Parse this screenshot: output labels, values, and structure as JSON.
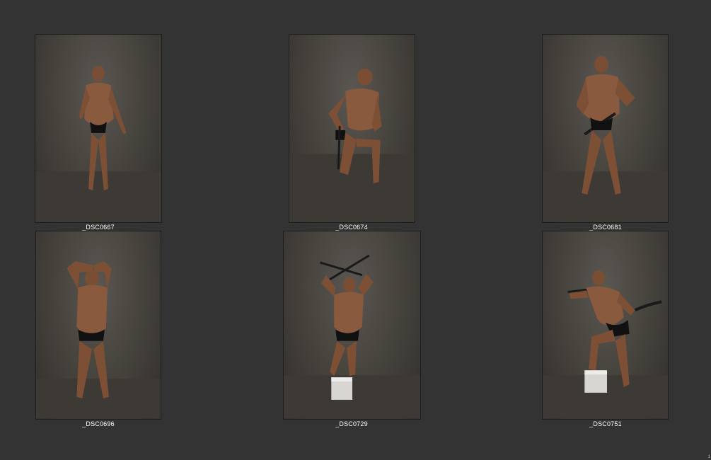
{
  "contact_sheet": {
    "photos": [
      {
        "filename": "_DSC0667",
        "pose": "standing-figure"
      },
      {
        "filename": "_DSC0674",
        "pose": "kneeling-figure-with-sword"
      },
      {
        "filename": "_DSC0681",
        "pose": "standing-figure-with-sword"
      },
      {
        "filename": "_DSC0696",
        "pose": "arms-overhead-figure"
      },
      {
        "filename": "_DSC0729",
        "pose": "figure-crossed-swords-on-box"
      },
      {
        "filename": "_DSC0751",
        "pose": "figure-swinging-sword-on-box"
      }
    ],
    "page_number": "1"
  },
  "colors": {
    "background": "#333333",
    "backdrop": "#48453f",
    "skin": "#8a5a3e",
    "garment": "#111111",
    "caption_text": "#ffffff"
  }
}
